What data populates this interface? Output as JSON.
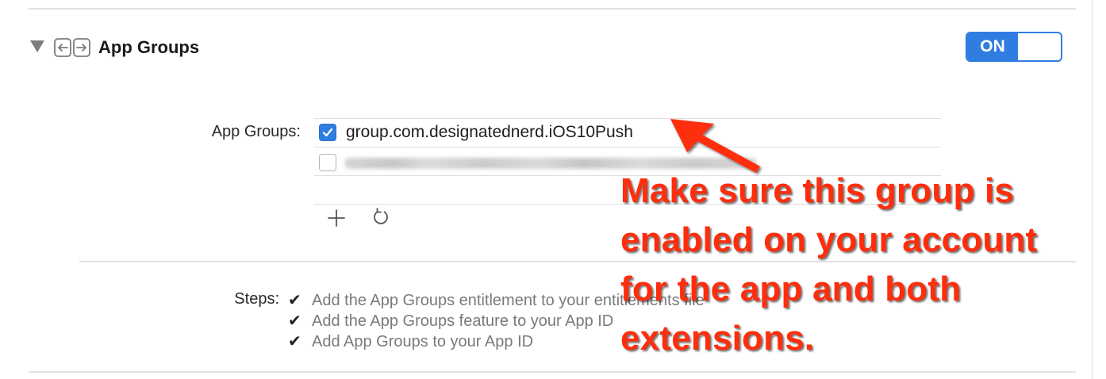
{
  "capability": {
    "title": "App Groups",
    "icon": "app-groups-icon",
    "toggle_label": "ON",
    "accent_color": "#2f7de1"
  },
  "app_groups": {
    "label": "App Groups:",
    "items": [
      {
        "id": "group.com.designatednerd.iOS10Push",
        "checked": true
      },
      {
        "id": "",
        "checked": false,
        "obscured": true
      }
    ],
    "add_icon": "plus-icon",
    "refresh_icon": "refresh-icon"
  },
  "steps": {
    "label": "Steps:",
    "items": [
      {
        "check": "✔",
        "text": "Add the App Groups entitlement to your entitlements file"
      },
      {
        "check": "✔",
        "text": "Add the App Groups feature to your App ID"
      },
      {
        "check": "✔",
        "text": "Add App Groups to your App ID"
      }
    ]
  },
  "annotation": {
    "lines": [
      "Make sure this group is",
      "enabled on your account",
      "for the app and both",
      "extensions."
    ],
    "color": "#ff2d0c"
  }
}
